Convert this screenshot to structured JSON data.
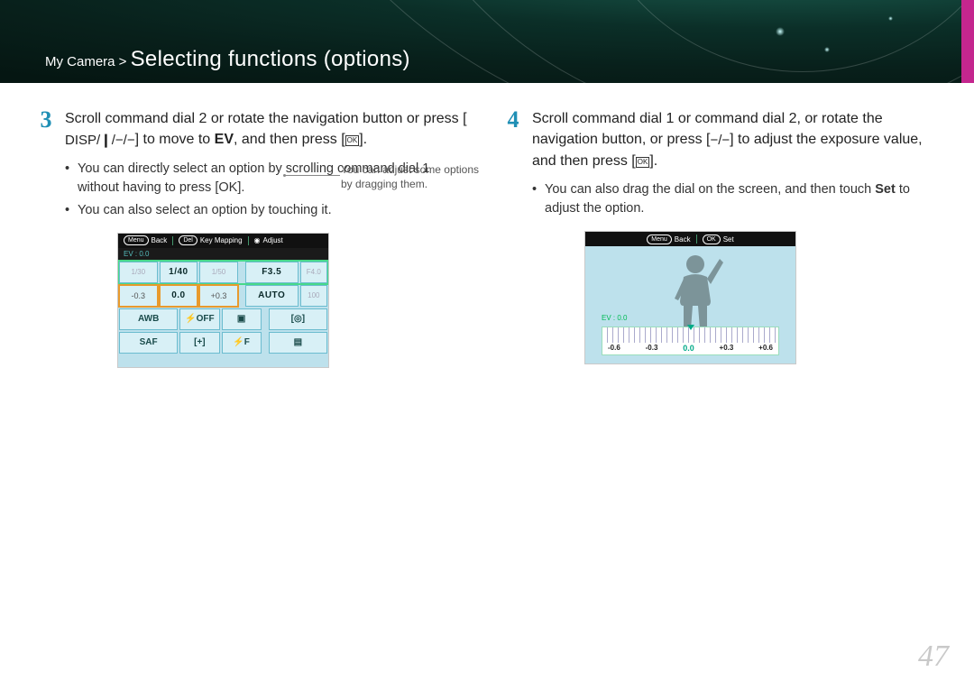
{
  "breadcrumb": {
    "path": "My Camera >",
    "title": "Selecting functions (options)"
  },
  "step3": {
    "num": "3",
    "text_a": "Scroll command dial 2 or rotate the navigation button or press [",
    "nav_glyphs": "DISP/❙/−/−",
    "text_b": "] to move to ",
    "bold": "EV",
    "text_c": ", and then press [",
    "ok": "OK",
    "text_d": "].",
    "bullets": [
      "You can directly select an option by scrolling command dial 1 without having to press [OK].",
      "You can also select an option by touching it."
    ]
  },
  "step4": {
    "num": "4",
    "text_a": "Scroll command dial 1 or command dial 2, or rotate the navigation button, or press [",
    "nav_glyphs": "−/−",
    "text_b": "] to adjust the exposure value, and then press [",
    "ok": "OK",
    "text_c": "].",
    "bullets": [
      "You can also drag the dial on the screen, and then touch Set to adjust the option."
    ]
  },
  "shot1": {
    "menu": "Menu",
    "back": "Back",
    "del": "Del",
    "keymap": "Key Mapping",
    "adjust": "Adjust",
    "ev": "EV : 0.0",
    "row1": [
      "1/30",
      "1/40",
      "1/50",
      "",
      "F3.5",
      "F4.0"
    ],
    "row2": [
      "-0.3",
      "0.0",
      "+0.3",
      "",
      "AUTO",
      "100"
    ],
    "row3": [
      "AWB",
      "⚡OFF",
      "▣",
      "",
      "[◎]",
      ""
    ],
    "row4": [
      "SAF",
      "[+]",
      "⚡F",
      "",
      "▤",
      ""
    ]
  },
  "shot2": {
    "menu": "Menu",
    "back": "Back",
    "ok": "OK",
    "set": "Set",
    "ev": "EV : 0.0",
    "scale": [
      "-0.6",
      "-0.3",
      "0.0",
      "+0.3",
      "+0.6"
    ]
  },
  "drag_note": "You can adjust some options by dragging them.",
  "pagenum": "47"
}
